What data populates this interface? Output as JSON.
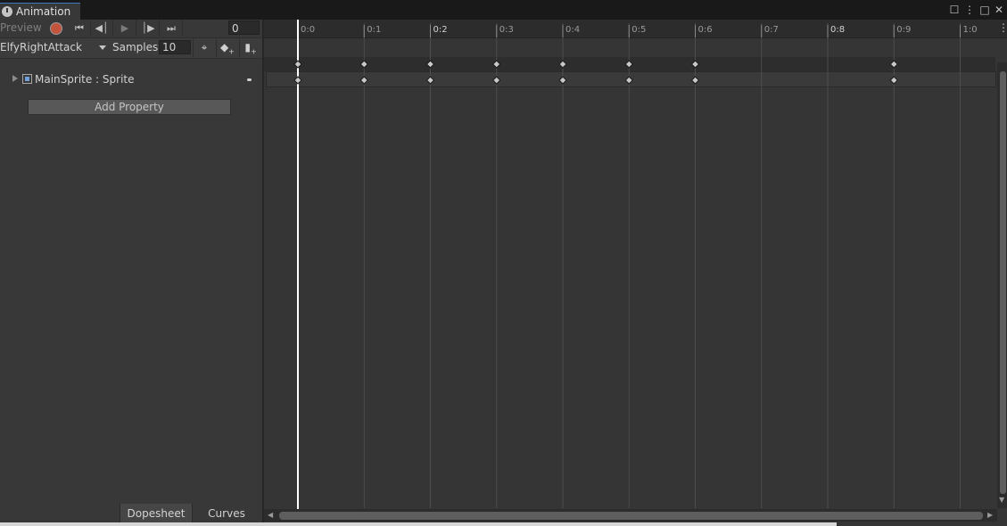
{
  "window": {
    "tab_title": "Animation",
    "buttons": [
      "lock-icon",
      "more-icon",
      "maximize-icon",
      "close-icon"
    ]
  },
  "toolbar": {
    "preview_label": "Preview",
    "record_icon": "record-icon",
    "first_key_icon": "first-key-icon",
    "prev_key_icon": "prev-key-icon",
    "play_icon": "play-icon",
    "next_key_icon": "next-key-icon",
    "last_key_icon": "last-key-icon",
    "frame_value": "0",
    "clip_name": "ElfyRightAttack",
    "samples_label": "Samples",
    "samples_value": "10",
    "record_color": "#c2543d"
  },
  "properties": [
    {
      "label": "MainSprite : Sprite"
    }
  ],
  "add_property_label": "Add Property",
  "bottom_tabs": {
    "dopesheet": "Dopesheet",
    "curves": "Curves"
  },
  "timeline": {
    "ticks": [
      "0:0",
      "0:1",
      "0:2",
      "0:3",
      "0:4",
      "0:5",
      "0:6",
      "0:7",
      "0:8",
      "0:9",
      "1:0"
    ],
    "keyframe_frames": [
      0,
      1,
      2,
      3,
      4,
      5,
      6,
      9
    ],
    "playhead_frame": 0,
    "accent_color": "#3a79bb"
  }
}
